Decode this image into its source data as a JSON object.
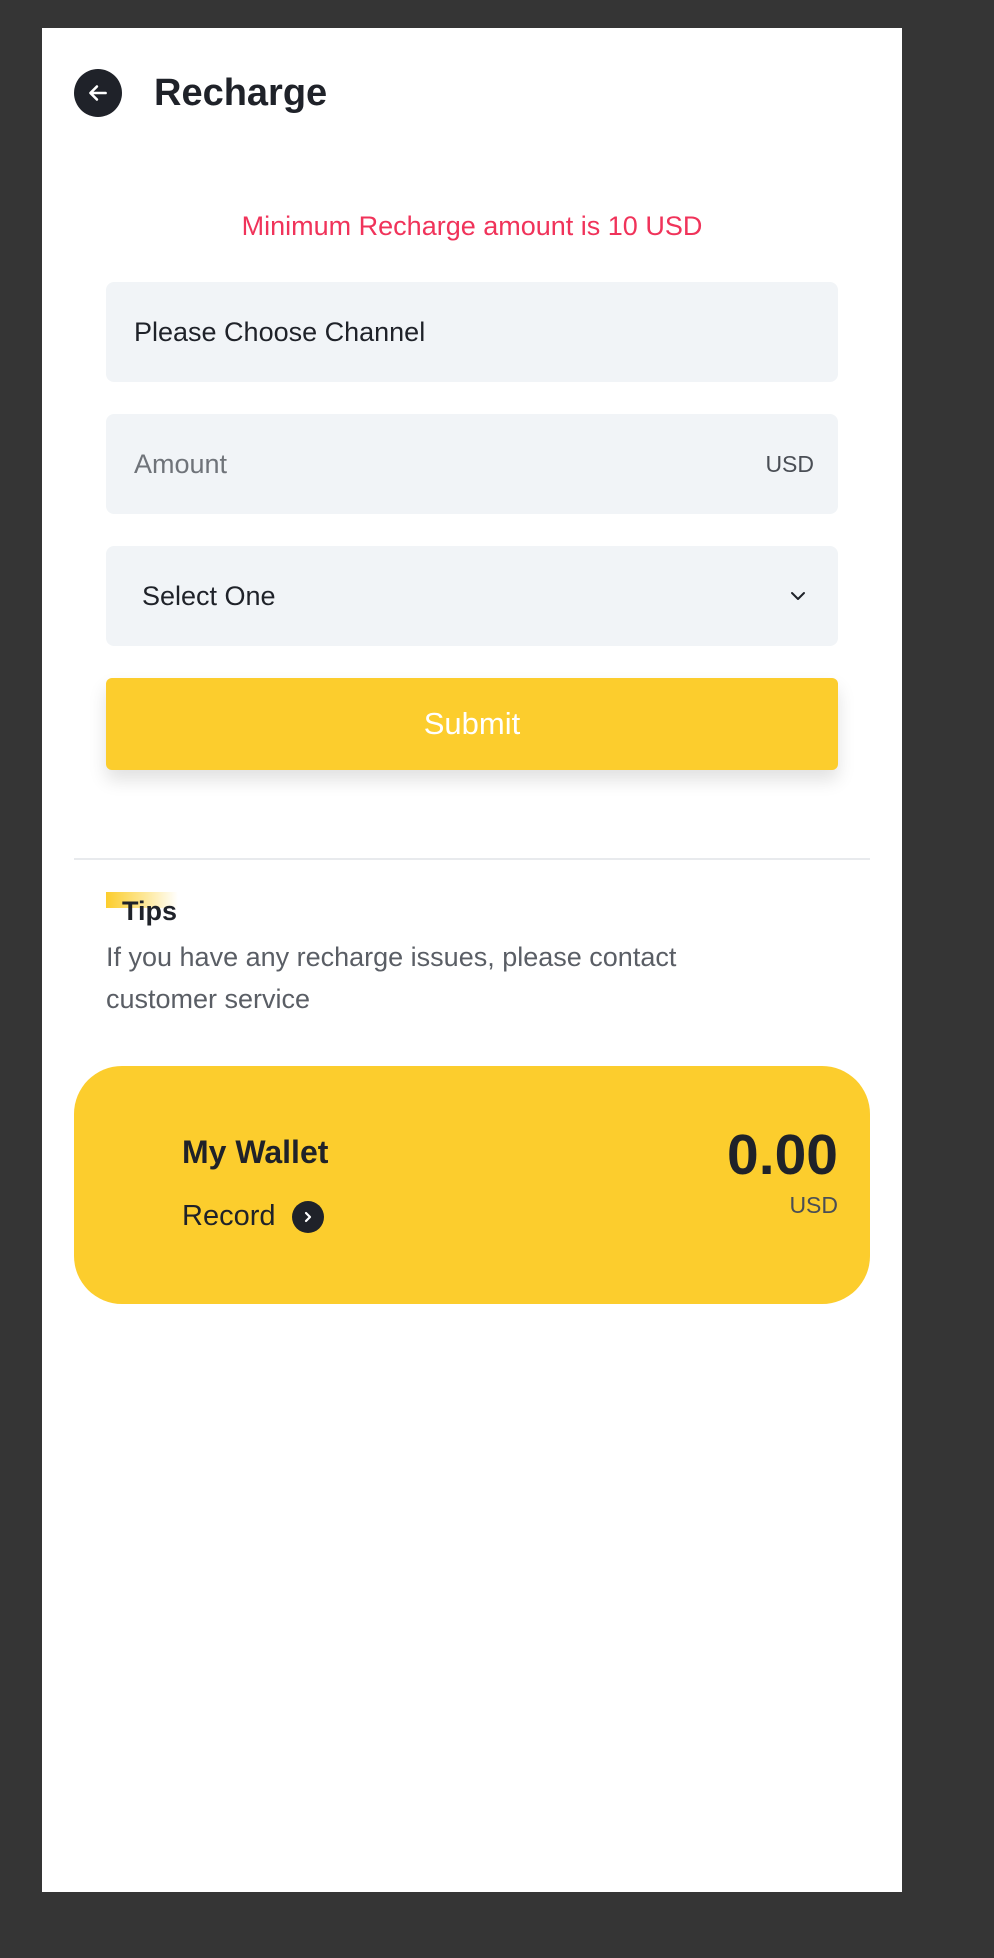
{
  "header": {
    "title": "Recharge"
  },
  "form": {
    "notice": "Minimum Recharge amount is 10 USD",
    "channel_placeholder": "Please Choose Channel",
    "amount_placeholder": "Amount",
    "amount_unit": "USD",
    "select_label": "Select One",
    "submit_label": "Submit"
  },
  "tips": {
    "title": "Tips",
    "text": "If you have any recharge issues, please contact customer service"
  },
  "wallet": {
    "title": "My Wallet",
    "record_label": "Record",
    "balance": "0.00",
    "unit": "USD"
  },
  "colors": {
    "accent": "#fccd2d",
    "notice": "#f0335a",
    "field_bg": "#f1f4f7",
    "dark": "#1f2229"
  },
  "icons": {
    "back": "arrow-left-icon",
    "dropdown": "chevron-down-icon",
    "record": "chevron-right-icon"
  }
}
